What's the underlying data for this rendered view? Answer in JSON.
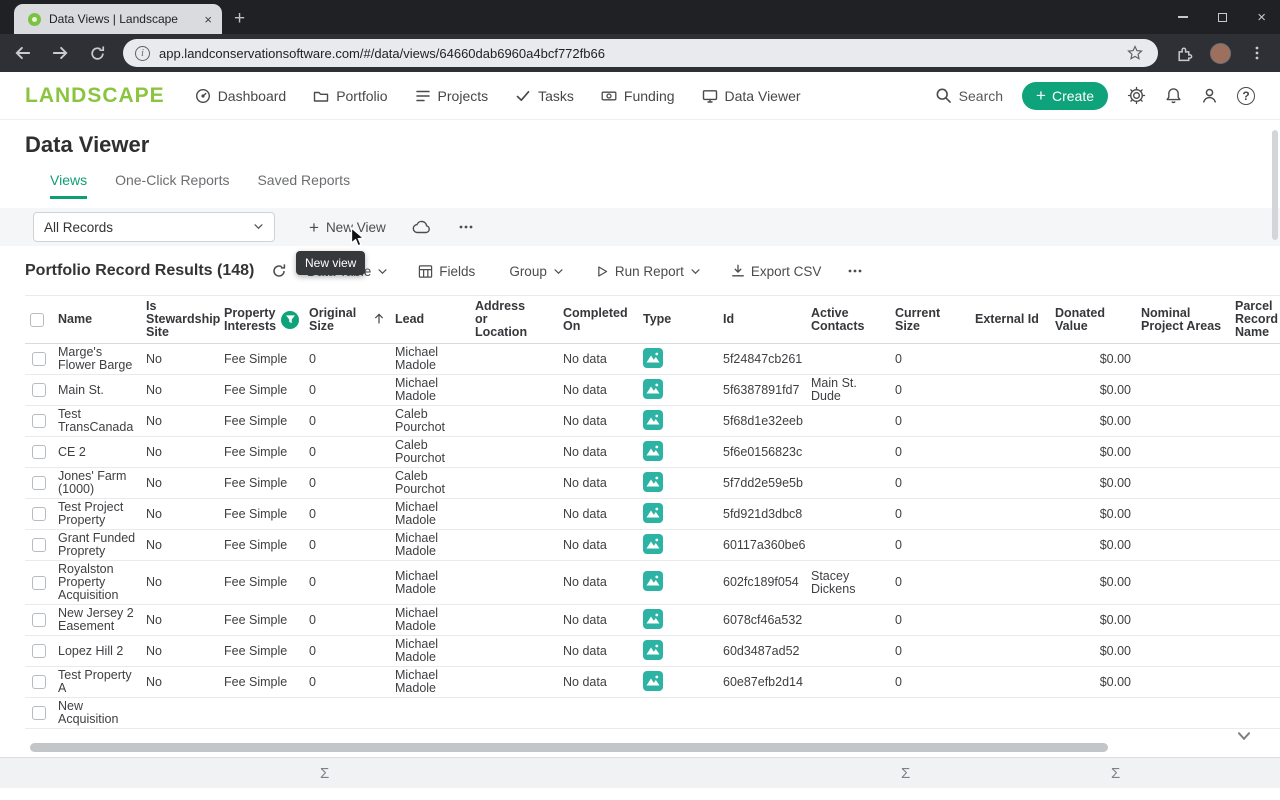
{
  "colors": {
    "brand_green": "#8bc53f",
    "accent_green": "#0d9e74",
    "create_button_green": "#0fa37c",
    "type_icon_teal": "#2cb3a4"
  },
  "browser": {
    "tab_title": "Data Views | Landscape",
    "url": "app.landconservationsoftware.com/#/data/views/64660dab6960a4bcf772fb66"
  },
  "app_nav": {
    "logo": "LANDSCAPE",
    "items": [
      "Dashboard",
      "Portfolio",
      "Projects",
      "Tasks",
      "Funding",
      "Data Viewer"
    ],
    "search": "Search",
    "create": "Create"
  },
  "page": {
    "title": "Data Viewer",
    "tabs": [
      "Views",
      "One-Click Reports",
      "Saved Reports"
    ],
    "active_tab": "Views"
  },
  "view_toolbar": {
    "selected_view": "All Records",
    "new_view": "New View",
    "tooltip": "New view"
  },
  "results_bar": {
    "title": "Portfolio Record Results (148)",
    "data_table": "Data Table",
    "fields": "Fields",
    "group": "Group",
    "run_report": "Run Report",
    "export_csv": "Export CSV"
  },
  "table": {
    "columns": [
      "Name",
      "Is Stewardship Site",
      "Property Interests",
      "Original Size",
      "Lead",
      "Address or Location",
      "Completed On",
      "Type",
      "Id",
      "Active Contacts",
      "Current Size",
      "External Id",
      "Donated Value",
      "Nominal Project Areas",
      "Parcel Record Name"
    ],
    "sorted_column": "Original Size",
    "filtered_column": "Property Interests",
    "rows": [
      {
        "name": "Marge's Flower Barge",
        "is_stewardship_site": "No",
        "property_interests": "Fee Simple",
        "original_size": "0",
        "lead": "Michael Madole",
        "address_or_location": "",
        "completed_on": "No data",
        "type_icon": true,
        "id": "5f24847cb261",
        "active_contacts": "",
        "current_size": "0",
        "external_id": "",
        "donated_value": "$0.00",
        "nominal_project_areas": "",
        "parcel_record_name": ""
      },
      {
        "name": "Main St.",
        "is_stewardship_site": "No",
        "property_interests": "Fee Simple",
        "original_size": "0",
        "lead": "Michael Madole",
        "address_or_location": "",
        "completed_on": "No data",
        "type_icon": true,
        "id": "5f6387891fd7",
        "active_contacts": "Main St. Dude",
        "current_size": "0",
        "external_id": "",
        "donated_value": "$0.00",
        "nominal_project_areas": "",
        "parcel_record_name": ""
      },
      {
        "name": "Test TransCanada",
        "is_stewardship_site": "No",
        "property_interests": "Fee Simple",
        "original_size": "0",
        "lead": "Caleb Pourchot",
        "address_or_location": "",
        "completed_on": "No data",
        "type_icon": true,
        "id": "5f68d1e32eeb",
        "active_contacts": "",
        "current_size": "0",
        "external_id": "",
        "donated_value": "$0.00",
        "nominal_project_areas": "",
        "parcel_record_name": ""
      },
      {
        "name": "CE 2",
        "is_stewardship_site": "No",
        "property_interests": "Fee Simple",
        "original_size": "0",
        "lead": "Caleb Pourchot",
        "address_or_location": "",
        "completed_on": "No data",
        "type_icon": true,
        "id": "5f6e0156823c",
        "active_contacts": "",
        "current_size": "0",
        "external_id": "",
        "donated_value": "$0.00",
        "nominal_project_areas": "",
        "parcel_record_name": ""
      },
      {
        "name": "Jones' Farm (1000)",
        "is_stewardship_site": "No",
        "property_interests": "Fee Simple",
        "original_size": "0",
        "lead": "Caleb Pourchot",
        "address_or_location": "",
        "completed_on": "No data",
        "type_icon": true,
        "id": "5f7dd2e59e5b",
        "active_contacts": "",
        "current_size": "0",
        "external_id": "",
        "donated_value": "$0.00",
        "nominal_project_areas": "",
        "parcel_record_name": ""
      },
      {
        "name": "Test Project Property",
        "is_stewardship_site": "No",
        "property_interests": "Fee Simple",
        "original_size": "0",
        "lead": "Michael Madole",
        "address_or_location": "",
        "completed_on": "No data",
        "type_icon": true,
        "id": "5fd921d3dbc8",
        "active_contacts": "",
        "current_size": "0",
        "external_id": "",
        "donated_value": "$0.00",
        "nominal_project_areas": "",
        "parcel_record_name": ""
      },
      {
        "name": "Grant Funded Proprety",
        "is_stewardship_site": "No",
        "property_interests": "Fee Simple",
        "original_size": "0",
        "lead": "Michael Madole",
        "address_or_location": "",
        "completed_on": "No data",
        "type_icon": true,
        "id": "60117a360be6",
        "active_contacts": "",
        "current_size": "0",
        "external_id": "",
        "donated_value": "$0.00",
        "nominal_project_areas": "",
        "parcel_record_name": ""
      },
      {
        "name": "Royalston Property Acquisition",
        "is_stewardship_site": "No",
        "property_interests": "Fee Simple",
        "original_size": "0",
        "lead": "Michael Madole",
        "address_or_location": "",
        "completed_on": "No data",
        "type_icon": true,
        "id": "602fc189f054",
        "active_contacts": "Stacey Dickens",
        "current_size": "0",
        "external_id": "",
        "donated_value": "$0.00",
        "nominal_project_areas": "",
        "parcel_record_name": ""
      },
      {
        "name": "New Jersey 2 Easement",
        "is_stewardship_site": "No",
        "property_interests": "Fee Simple",
        "original_size": "0",
        "lead": "Michael Madole",
        "address_or_location": "",
        "completed_on": "No data",
        "type_icon": true,
        "id": "6078cf46a532",
        "active_contacts": "",
        "current_size": "0",
        "external_id": "",
        "donated_value": "$0.00",
        "nominal_project_areas": "",
        "parcel_record_name": ""
      },
      {
        "name": "Lopez Hill 2",
        "is_stewardship_site": "No",
        "property_interests": "Fee Simple",
        "original_size": "0",
        "lead": "Michael Madole",
        "address_or_location": "",
        "completed_on": "No data",
        "type_icon": true,
        "id": "60d3487ad52",
        "active_contacts": "",
        "current_size": "0",
        "external_id": "",
        "donated_value": "$0.00",
        "nominal_project_areas": "",
        "parcel_record_name": ""
      },
      {
        "name": "Test Property A",
        "is_stewardship_site": "No",
        "property_interests": "Fee Simple",
        "original_size": "0",
        "lead": "Michael Madole",
        "address_or_location": "",
        "completed_on": "No data",
        "type_icon": true,
        "id": "60e87efb2d14",
        "active_contacts": "",
        "current_size": "0",
        "external_id": "",
        "donated_value": "$0.00",
        "nominal_project_areas": "",
        "parcel_record_name": ""
      },
      {
        "name": "New Acquisition",
        "is_stewardship_site": "",
        "property_interests": "",
        "original_size": "",
        "lead": "",
        "address_or_location": "",
        "completed_on": "",
        "type_icon": false,
        "id": "",
        "active_contacts": "",
        "current_size": "",
        "external_id": "",
        "donated_value": "",
        "nominal_project_areas": "",
        "parcel_record_name": ""
      }
    ]
  },
  "footer": {
    "aggregate_symbol": "Σ"
  }
}
